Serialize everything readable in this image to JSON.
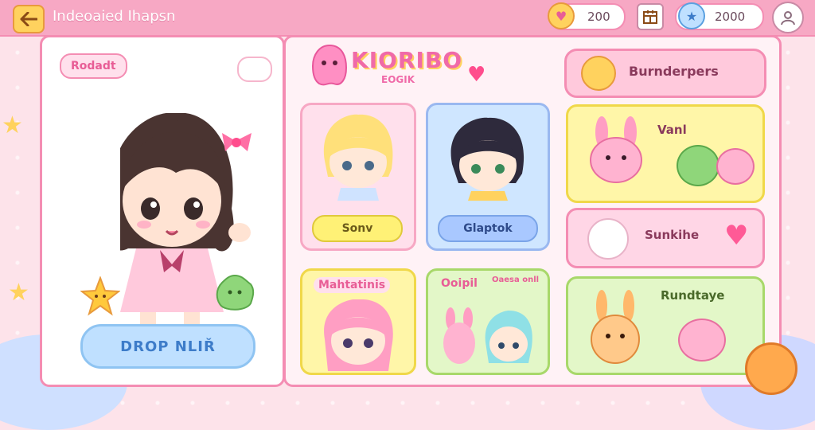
{
  "header": {
    "title": "Indeoaied Ihapsn",
    "coins": "200",
    "gems": "2000"
  },
  "left_panel": {
    "badge": "Rodadt",
    "button": "DROP NLIŘ"
  },
  "main": {
    "logo_title": "KIORIBO",
    "logo_sub": "EOGIK",
    "top_banner": "Burnderpers",
    "cards": [
      {
        "label": "Sonv"
      },
      {
        "label": "Glaptok"
      },
      {
        "label": "Vanl"
      },
      {
        "label": "Sunkihe"
      },
      {
        "label": "Mahtatinis"
      },
      {
        "label": "Ooipil",
        "sublabel": "Oaesa onll"
      },
      {
        "label": "Rundtaye"
      }
    ]
  },
  "colors": {
    "accent_pink": "#f48db3",
    "yellow": "#ffd25e",
    "blue": "#8fc4f2"
  }
}
